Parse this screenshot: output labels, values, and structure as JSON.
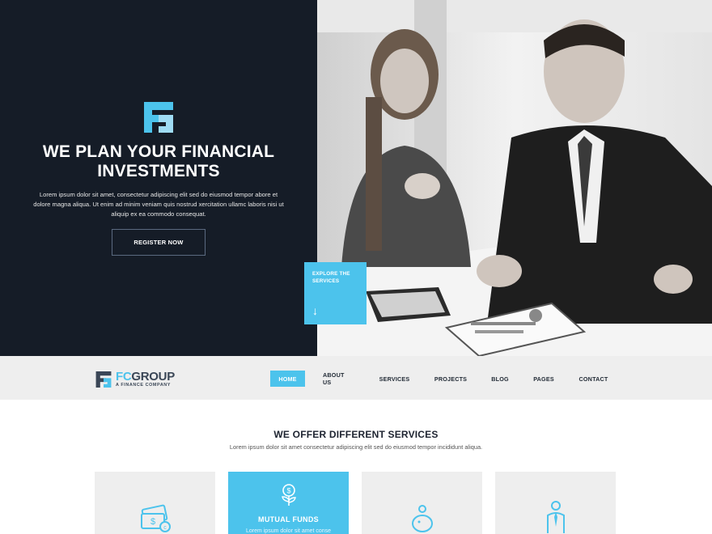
{
  "hero": {
    "title": "WE PLAN YOUR FINANCIAL INVESTMENTS",
    "text": "Lorem ipsum dolor sit amet, consectetur adipiscing elit sed do eiusmod tempor abore et dolore magna aliqua. Ut enim ad minim veniam quis nostrud xercitation ullamc laboris nisi ut aliquip ex ea commodo consequat.",
    "register_label": "REGISTER NOW",
    "explore_label": "EXPLORE THE SERVICES",
    "explore_arrow": "↓"
  },
  "brand": {
    "name_accent": "FC",
    "name_rest": "GROUP",
    "subtitle": "A FINANCE COMPANY"
  },
  "nav": {
    "items": [
      "HOME",
      "ABOUT US",
      "SERVICES",
      "PROJECTS",
      "BLOG",
      "PAGES",
      "CONTACT"
    ],
    "active": "HOME"
  },
  "services": {
    "title": "WE OFFER DIFFERENT SERVICES",
    "subtitle": "Lorem ipsum dolor sit amet consectetur adipiscing elit sed do eiusmod tempor incididunt aliqua.",
    "cards": [
      {
        "icon": "money-cash-icon",
        "title": "",
        "text": ""
      },
      {
        "icon": "money-plant-icon",
        "title": "MUTUAL FUNDS",
        "text": "Lorem ipsum dolor sit amet conse"
      },
      {
        "icon": "piggy-bank-icon",
        "title": "",
        "text": ""
      },
      {
        "icon": "businessman-icon",
        "title": "",
        "text": ""
      }
    ]
  },
  "colors": {
    "accent": "#4cc3ec",
    "hero_dark": "#151c27",
    "nav_bg": "#eeeeee",
    "card_bg": "#eeeeee"
  }
}
